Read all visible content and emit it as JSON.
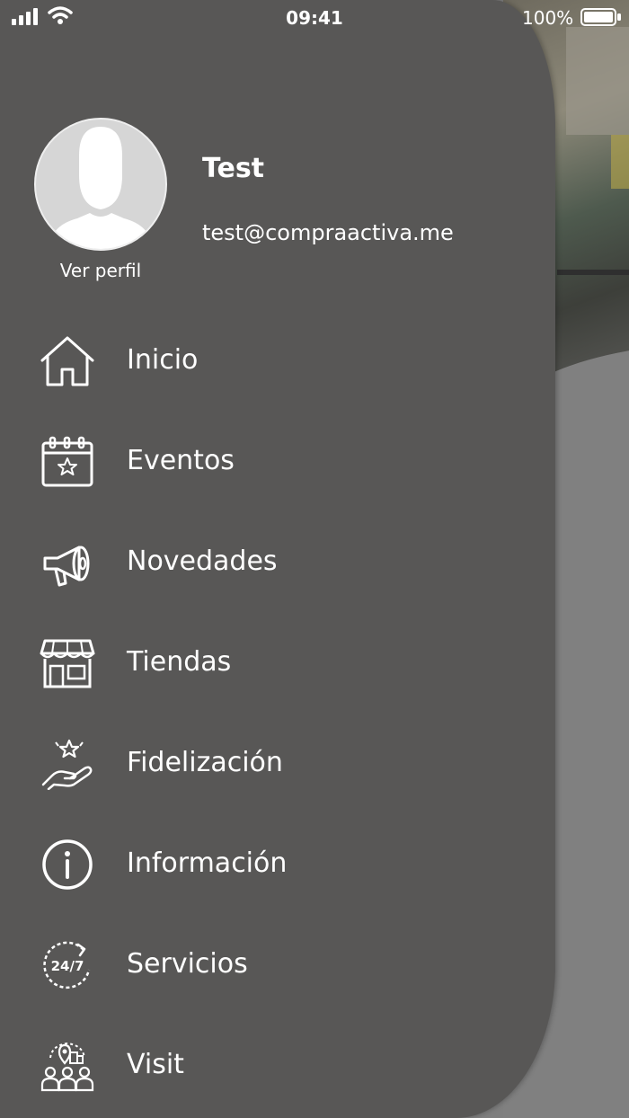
{
  "status_bar": {
    "time": "09:41",
    "battery": "100%"
  },
  "profile": {
    "name": "Test",
    "email": "test@compraactiva.me",
    "view_profile": "Ver perfil"
  },
  "menu": [
    {
      "label": "Inicio",
      "icon": "home-icon"
    },
    {
      "label": "Eventos",
      "icon": "calendar-star-icon"
    },
    {
      "label": "Novedades",
      "icon": "megaphone-icon"
    },
    {
      "label": "Tiendas",
      "icon": "store-icon"
    },
    {
      "label": "Fidelización",
      "icon": "hand-star-icon"
    },
    {
      "label": "Información",
      "icon": "info-icon"
    },
    {
      "label": "Servicios",
      "icon": "24-7-icon"
    },
    {
      "label": "Visit",
      "icon": "visit-map-people-icon"
    }
  ],
  "colors": {
    "drawer": "#585756",
    "background": "#808080",
    "text": "#ffffff"
  }
}
